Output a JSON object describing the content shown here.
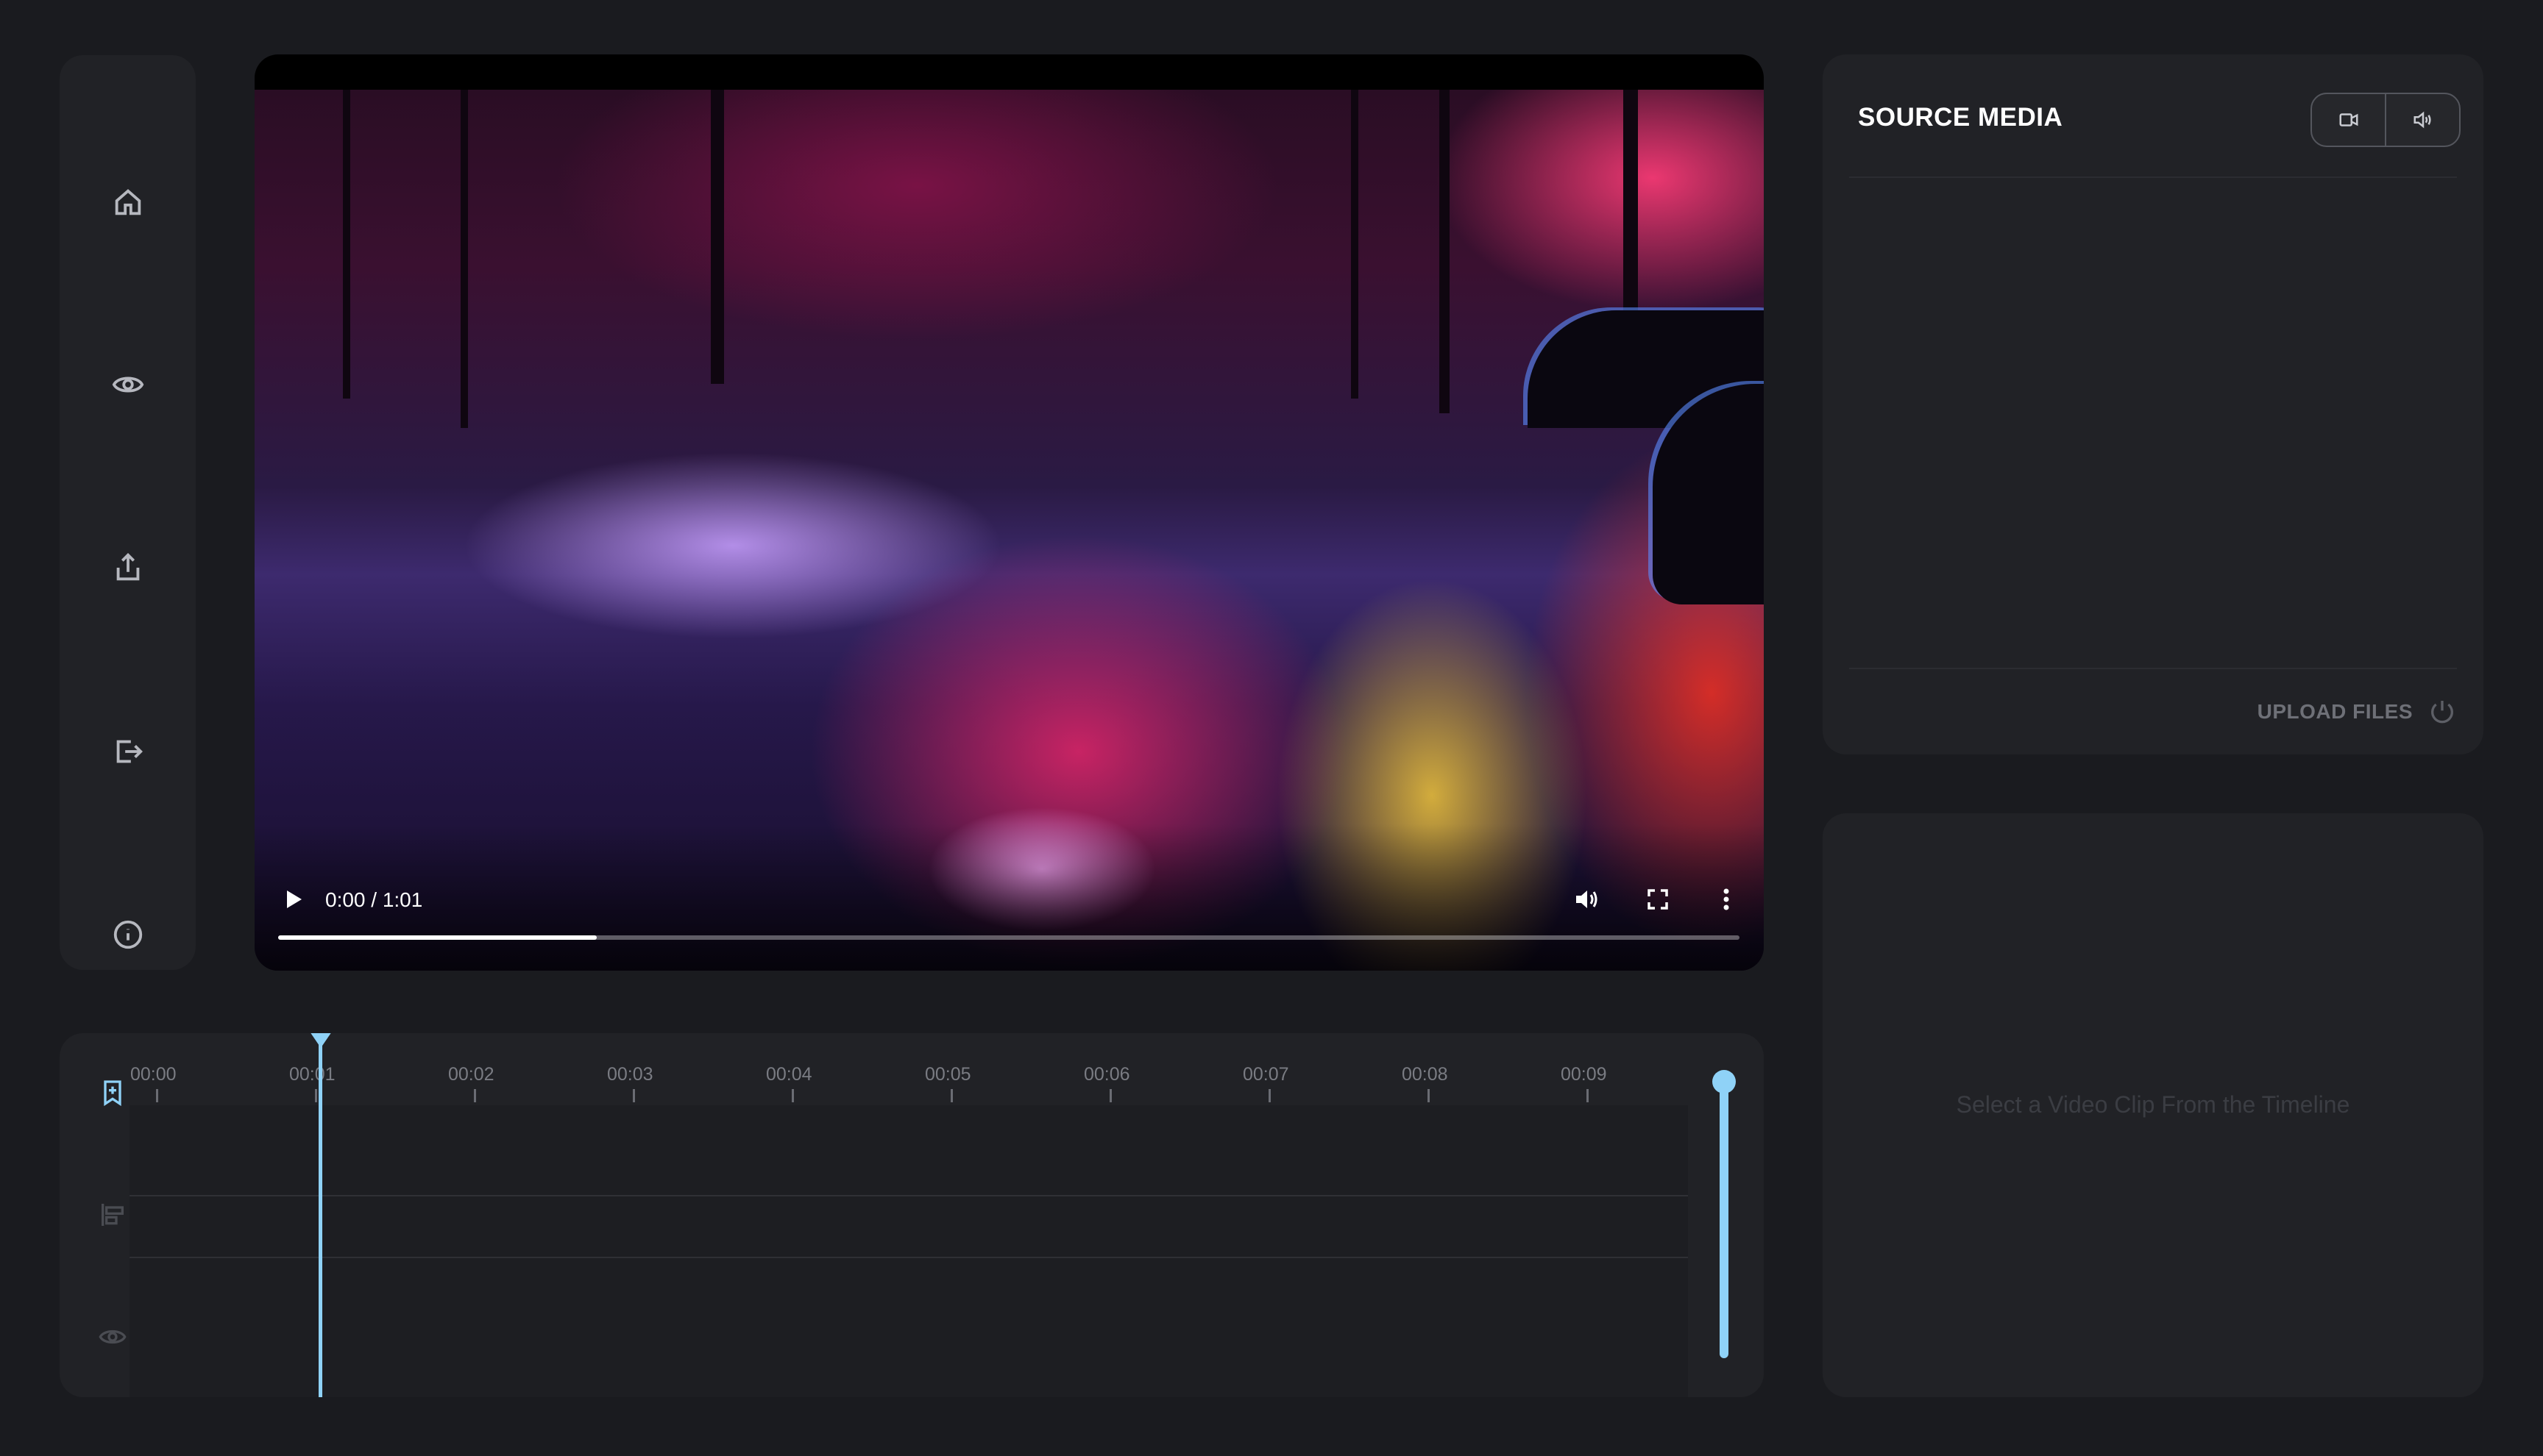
{
  "sidebar": {
    "items": [
      {
        "name": "home",
        "icon": "home-icon"
      },
      {
        "name": "preview",
        "icon": "eye-icon"
      },
      {
        "name": "export",
        "icon": "share-icon"
      },
      {
        "name": "logout",
        "icon": "logout-icon"
      },
      {
        "name": "info",
        "icon": "info-icon"
      }
    ]
  },
  "player": {
    "time_display": "0:00 / 1:01",
    "progress_fraction": 0.218,
    "controls": [
      "play-icon",
      "volume-icon",
      "fullscreen-icon",
      "more-vertical-icon"
    ]
  },
  "source_media": {
    "title": "SOURCE MEDIA",
    "toggle": [
      {
        "name": "video",
        "icon": "video-camera-icon"
      },
      {
        "name": "audio",
        "icon": "speaker-icon"
      }
    ],
    "upload_label": "UPLOAD FILES",
    "upload_icon": "power-icon"
  },
  "clip_panel": {
    "placeholder": "Select a Video Clip From the Timeline"
  },
  "timeline": {
    "tick_labels": [
      "00:00",
      "00:01",
      "00:02",
      "00:03",
      "00:04",
      "00:05",
      "00:06",
      "00:07",
      "00:08",
      "00:09"
    ],
    "tools": [
      {
        "name": "bookmark-add",
        "icon": "bookmark-plus-icon",
        "active": true
      },
      {
        "name": "align-left",
        "icon": "align-left-icon",
        "active": false
      },
      {
        "name": "visibility",
        "icon": "eye-icon",
        "active": false
      }
    ]
  },
  "colors": {
    "background": "#1a1b1f",
    "panel": "#212226",
    "accent": "#8fd2f7",
    "muted_text": "#6e7077"
  }
}
